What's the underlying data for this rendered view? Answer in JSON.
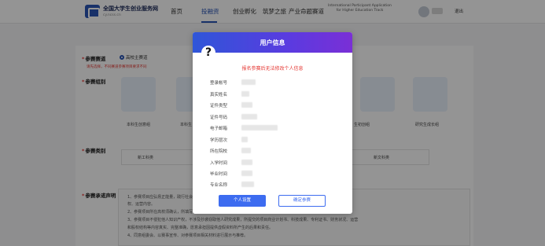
{
  "header": {
    "site_title": "全国大学生创业服务网",
    "site_subtitle": "cy.ncss.cn",
    "nav": [
      "首页",
      "投融资",
      "创业孵化",
      "筑梦之旅",
      "产业命题赛道"
    ],
    "international": "International Participant Application for Higher Education Track",
    "logout": "退出"
  },
  "page": {
    "track_label": "参赛赛道",
    "track_option": "高校主赛道",
    "track_warning": "请先选择，不同赛道参赛项目要求不同",
    "group_label": "参赛组别",
    "groups": [
      "本科生创意组",
      "本科生",
      "",
      "",
      "生初创组",
      "研究生成长组"
    ],
    "category_label": "参赛类别",
    "categories": [
      "新工科类",
      "",
      "新文科类"
    ],
    "promise_label": "参赛承诺声明",
    "promise_lines": [
      "1、参赛项目应弘扬正能量，践行社会主义核心价值观，真实、健康、合法，无任何不良信息，项目立意积极向上，且其知识产",
      "权、运营内容。",
      "2、参赛项目所在高校须确认，所填写信息真实有效。",
      "3、参赛项目不侵犯他人知识产权，不涉及抄袭窃取他人研究成果，所提交的项目商业计划书、科技成果、专利证书、财务状况、运营",
      "和股权结构等内容真实、完整准确，愿意承担因提供虚假资料所产生的后果和责任。",
      "4、同意组委会、以赛事宣传、对参赛项目相关材料进行展示与推荐。"
    ]
  },
  "modal": {
    "title": "用户信息",
    "help_icon": "?",
    "warning": "报名参赛后无法修改个人信息",
    "fields": [
      "登录帐号",
      "真实姓名",
      "证件类型",
      "证件号码",
      "电子邮箱",
      "学历层次",
      "所在院校",
      "入学时间",
      "毕业时间",
      "专业名称"
    ],
    "btn_personal": "个人设置",
    "btn_confirm": "确定参赛"
  },
  "colors": {
    "primary": "#3d6cf0",
    "warning": "#e53935",
    "header_gradient_start": "#2f56d8",
    "header_gradient_end": "#7a2fd6"
  }
}
